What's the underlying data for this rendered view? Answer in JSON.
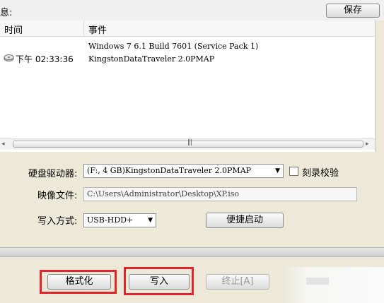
{
  "top": {
    "message_label": "息:",
    "save_button": "保存"
  },
  "log": {
    "columns": {
      "time": "时间",
      "event": "事件"
    },
    "rows": [
      {
        "time": "",
        "event": "Windows 7 6.1 Build 7601 (Service Pack 1)"
      },
      {
        "time": "下午 02:33:36",
        "event": "KingstonDataTraveler 2.0PMAP",
        "icon": "disk-icon"
      }
    ]
  },
  "scrollbar": {
    "left_arrow": "◂",
    "grip": "|||",
    "right_arrow": "▸"
  },
  "form": {
    "drive_label": "硬盘驱动器:",
    "drive_value": "(F:, 4 GB)KingstonDataTraveler 2.0PMAP",
    "verify_label": "刻录校验",
    "image_label": "映像文件:",
    "image_value": "C:\\Users\\Administrator\\Desktop\\XP.iso",
    "mode_label": "写入方式:",
    "mode_value": "USB-HDD+",
    "quickboot_button": "便捷启动"
  },
  "actions": {
    "format_button": "格式化",
    "write_button": "写入",
    "stop_button": "终止[A]"
  },
  "colors": {
    "highlight": "#e0262b",
    "window_bg": "#ece9d8"
  }
}
